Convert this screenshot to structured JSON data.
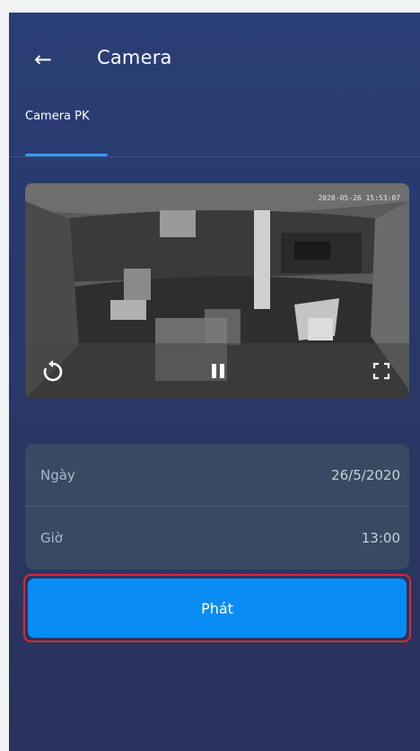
{
  "header": {
    "back_icon": "arrow-left-icon",
    "title": "Camera"
  },
  "tabs": [
    {
      "label": "Camera PK",
      "active": true
    }
  ],
  "video": {
    "timestamp": "2020-05-26 15:53:07",
    "controls": {
      "replay_icon": "replay-icon",
      "pause_icon": "pause-icon",
      "fullscreen_icon": "fullscreen-icon"
    }
  },
  "playback": {
    "date_label": "Ngày",
    "date_value": "26/5/2020",
    "time_label": "Giờ",
    "time_value": "13:00"
  },
  "actions": {
    "play_label": "Phát"
  },
  "colors": {
    "background_top": "#2a3f76",
    "background_bottom": "#2a325c",
    "accent": "#0a8cf5",
    "card": "#384a62",
    "highlight_border": "#e0252f"
  }
}
